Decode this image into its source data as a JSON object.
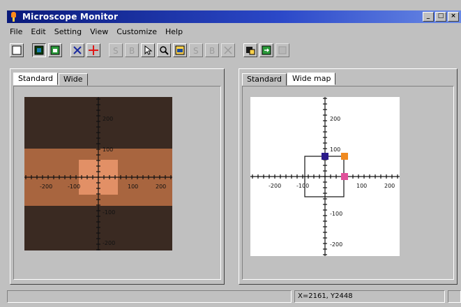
{
  "window": {
    "title": "Microscope Monitor",
    "btn_min": "_",
    "btn_max": "□",
    "btn_close": "×"
  },
  "menu": [
    "File",
    "Edit",
    "Setting",
    "View",
    "Customize",
    "Help"
  ],
  "left_panel": {
    "tabs": [
      "Standard",
      "Wide"
    ],
    "active_tab": "Standard",
    "axis_labels": {
      "x_neg2": "-200",
      "x_neg1": "-100",
      "x_pos1": "100",
      "x_pos2": "200",
      "y_pos2": "200",
      "y_pos1": "100",
      "y_neg1": "-100",
      "y_neg2": "-200"
    }
  },
  "right_panel": {
    "tabs": [
      "Standard",
      "Wide map"
    ],
    "active_tab": "Wide map",
    "axis_labels": {
      "x_neg2": "-200",
      "x_neg1": "-100",
      "x_pos1": "100",
      "x_pos2": "200",
      "y_pos2": "200",
      "y_pos1": "100",
      "y_neg1": "-100",
      "y_neg2": "-200"
    },
    "marker_colors": {
      "navy": "#2a1a8a",
      "orange": "#f08a20",
      "pink": "#e0509a"
    }
  },
  "statusbar": {
    "coords": "X=2161, Y2448"
  },
  "colors": {
    "title_left": "#0a1a7a",
    "title_right": "#6a8ae6",
    "face": "#c0c0c0"
  }
}
